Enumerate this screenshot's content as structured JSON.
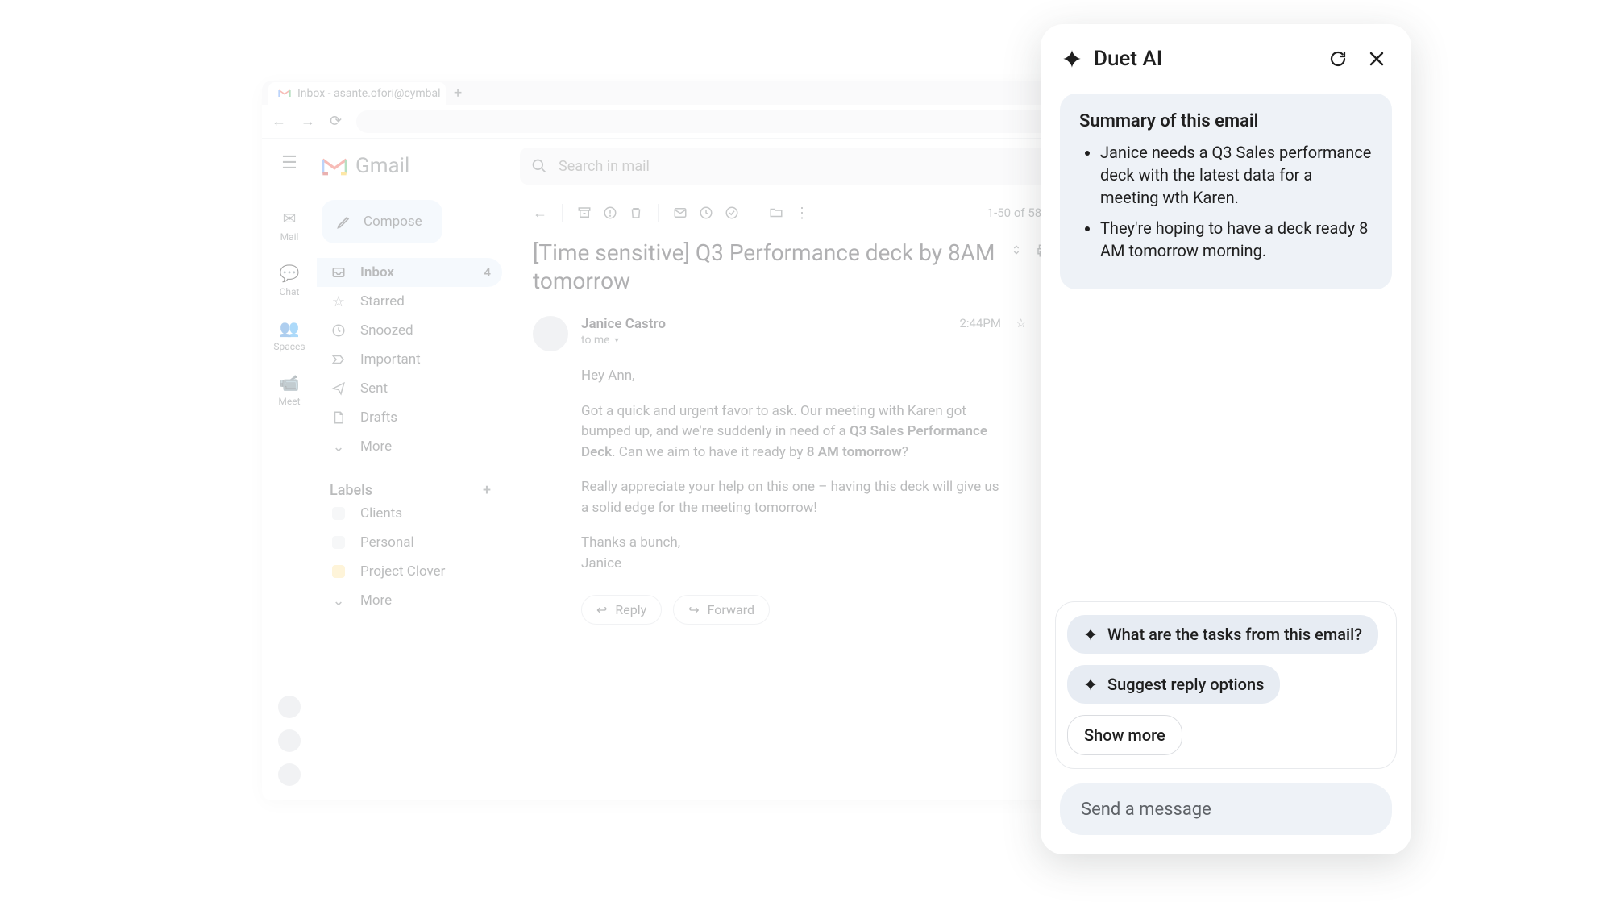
{
  "browser": {
    "tab_title": "Inbox - asante.ofori@cymbal"
  },
  "gmail": {
    "app_name": "Gmail",
    "search_placeholder": "Search in mail",
    "rail": [
      {
        "label": "Mail"
      },
      {
        "label": "Chat"
      },
      {
        "label": "Spaces"
      },
      {
        "label": "Meet"
      }
    ],
    "compose_label": "Compose",
    "nav": [
      {
        "label": "Inbox",
        "count": "4",
        "active": true
      },
      {
        "label": "Starred"
      },
      {
        "label": "Snoozed"
      },
      {
        "label": "Important"
      },
      {
        "label": "Sent"
      },
      {
        "label": "Drafts"
      },
      {
        "label": "More"
      }
    ],
    "labels_header": "Labels",
    "labels": [
      {
        "label": "Clients",
        "color": "#e8eaed"
      },
      {
        "label": "Personal",
        "color": "#e8eaed"
      },
      {
        "label": "Project Clover",
        "color": "#fde293"
      },
      {
        "label": "More"
      }
    ],
    "list_count": "1-50 of 58",
    "subject": "[Time sensitive] Q3 Performance deck by 8AM tomorrow",
    "sender": "Janice Castro",
    "to_line": "to me",
    "time": "2:44PM",
    "body": {
      "greeting": "Hey Ann,",
      "p1_a": "Got a quick and urgent favor to ask. Our meeting with Karen got bumped up, and we're suddenly in need of a ",
      "p1_bold1": "Q3 Sales Performance Deck",
      "p1_b": ". Can we aim to have it ready by ",
      "p1_bold2": "8 AM tomorrow",
      "p1_c": "?",
      "p2": "Really appreciate your help on this one – having this deck will give us a solid edge for the meeting tomorrow!",
      "signoff1": "Thanks a bunch,",
      "signoff2": "Janice"
    },
    "reply_label": "Reply",
    "forward_label": "Forward"
  },
  "duet": {
    "title": "Duet AI",
    "summary_title": "Summary of this email",
    "bullets": [
      "Janice needs a Q3 Sales performance deck with the latest data for a meeting wth Karen.",
      "They're hoping to have a deck ready 8 AM tomorrow morning."
    ],
    "suggestions": [
      "What are the tasks from this email?",
      "Suggest reply options"
    ],
    "show_more": "Show more",
    "input_placeholder": "Send a message"
  }
}
